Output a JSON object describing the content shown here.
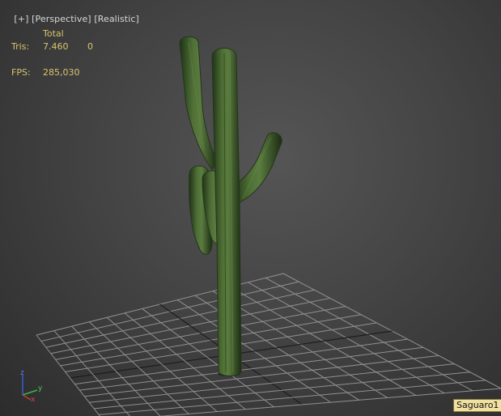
{
  "viewport": {
    "label_plus": "[+]",
    "label_view": "[Perspective]",
    "label_shading": "[Realistic]"
  },
  "stats": {
    "header_total": "Total",
    "tris_label": "Tris:",
    "tris_total": "7.460",
    "tris_selected": "0",
    "fps_label": "FPS:",
    "fps_value": "285,030"
  },
  "object": {
    "name": "Saguaro1"
  },
  "axis": {
    "x": "x",
    "y": "y",
    "z": "z"
  },
  "colors": {
    "grid": "#9a9a9a",
    "grid_center": "#1a1a1a",
    "cactus": "#3d5a2a",
    "stats_text": "#d8c56a"
  }
}
